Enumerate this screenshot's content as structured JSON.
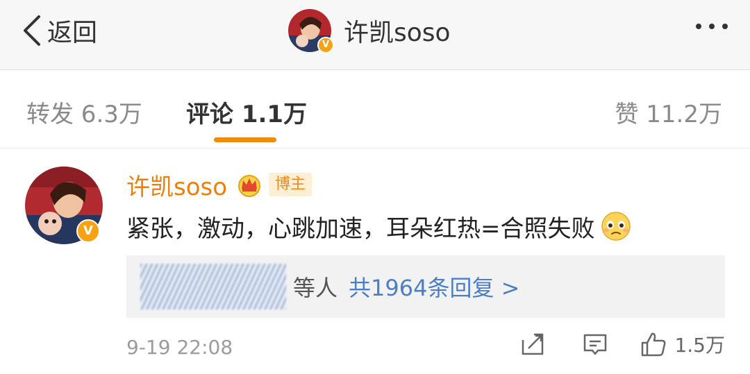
{
  "nav": {
    "back_label": "返回",
    "title": "许凯soso"
  },
  "tabs": [
    {
      "label": "转发 6.3万"
    },
    {
      "label": "评论 1.1万"
    },
    {
      "label": "赞 11.2万"
    }
  ],
  "comment": {
    "author": "许凯soso",
    "badge": "博主",
    "text": "紧张，激动，心跳加速，耳朵红热=合照失败",
    "replies": {
      "people": "等人",
      "count_label": "共1964条回复 >"
    },
    "time": "9-19 22:08",
    "like_count": "1.5万"
  },
  "colors": {
    "accent": "#f08a0a",
    "author_name": "#eb7f0a",
    "link": "#4a7ec7"
  }
}
